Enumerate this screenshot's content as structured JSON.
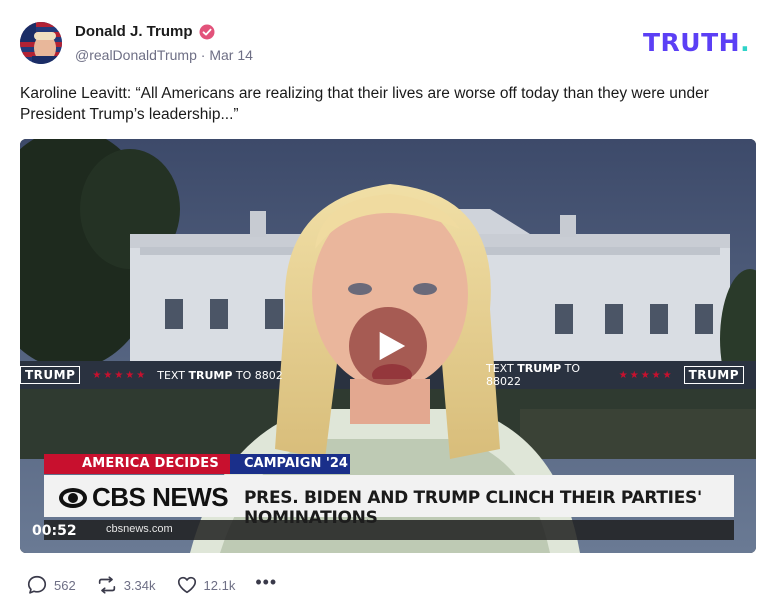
{
  "post": {
    "author_name": "Donald J. Trump",
    "handle": "@realDonaldTrump",
    "separator": "·",
    "date": "Mar 14",
    "text": "Karoline Leavitt: “All Americans are realizing that their lives are worse off today than they were under President Trump’s leadership...”"
  },
  "brand": {
    "logo_text": "TRUTH",
    "logo_dot": ".",
    "logo_color": "#5b3ff5",
    "dot_color": "#2fd3c8"
  },
  "video": {
    "duration": "00:52",
    "play_icon": "play-icon",
    "lower_third": {
      "tag_left": "AMERICA DECIDES",
      "tag_right": "CAMPAIGN '24",
      "network": "CBS NEWS",
      "headline": "PRES. BIDEN AND TRUMP CLINCH THEIR PARTIES' NOMINATIONS",
      "url": "cbsnews.com"
    },
    "background_sign": {
      "logo": "TRUMP",
      "stars": "★★★★★",
      "text_prefix": "TEXT ",
      "text_bold": "TRUMP",
      "text_suffix_left": " TO 8802",
      "text_suffix_right": " TO 88022"
    }
  },
  "actions": {
    "replies": "562",
    "retruths": "3.34k",
    "likes": "12.1k",
    "more": "•••"
  }
}
